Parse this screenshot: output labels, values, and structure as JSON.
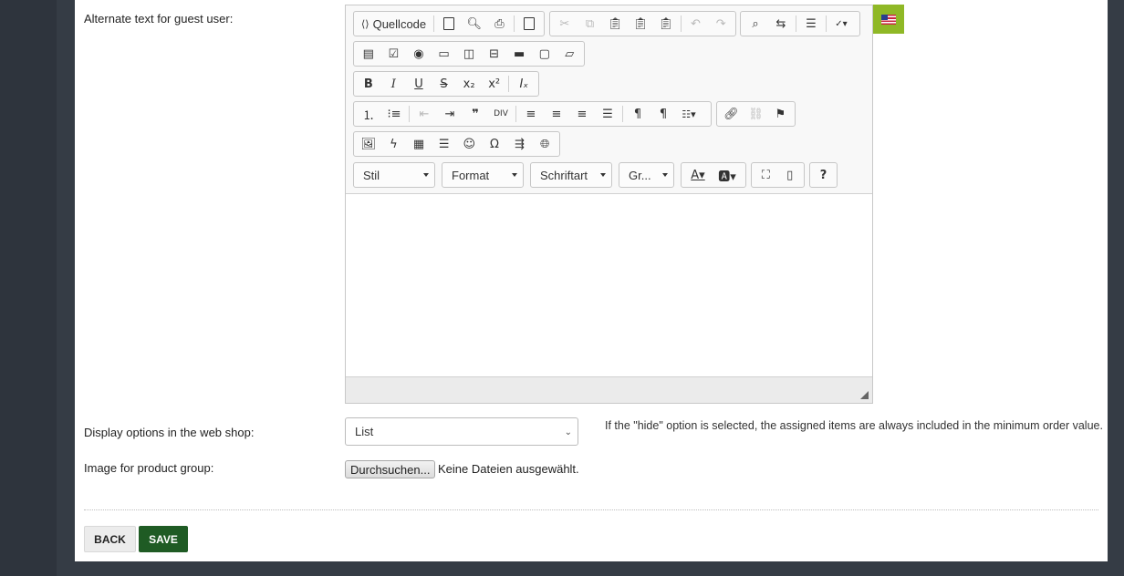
{
  "labels": {
    "guest_text": "Alternate text for guest user:",
    "display_options": "Display options in the web shop:",
    "image_group": "Image for product group:"
  },
  "editor": {
    "source_label": "Quellcode",
    "combos": {
      "style": "Stil",
      "format": "Format",
      "font": "Schriftart",
      "size": "Gr..."
    },
    "language_flag": "us-flag-icon"
  },
  "display_select": {
    "value": "List"
  },
  "hint": "If the \"hide\" option is selected, the assigned items are always included in the minimum order value.",
  "file_input": {
    "button": "Durchsuchen...",
    "status": "Keine Dateien ausgewählt."
  },
  "actions": {
    "back": "BACK",
    "save": "SAVE"
  },
  "colors": {
    "save_bg": "#1f5b24",
    "flag_bg": "#8fb826",
    "sidebar": "#2e343d"
  }
}
